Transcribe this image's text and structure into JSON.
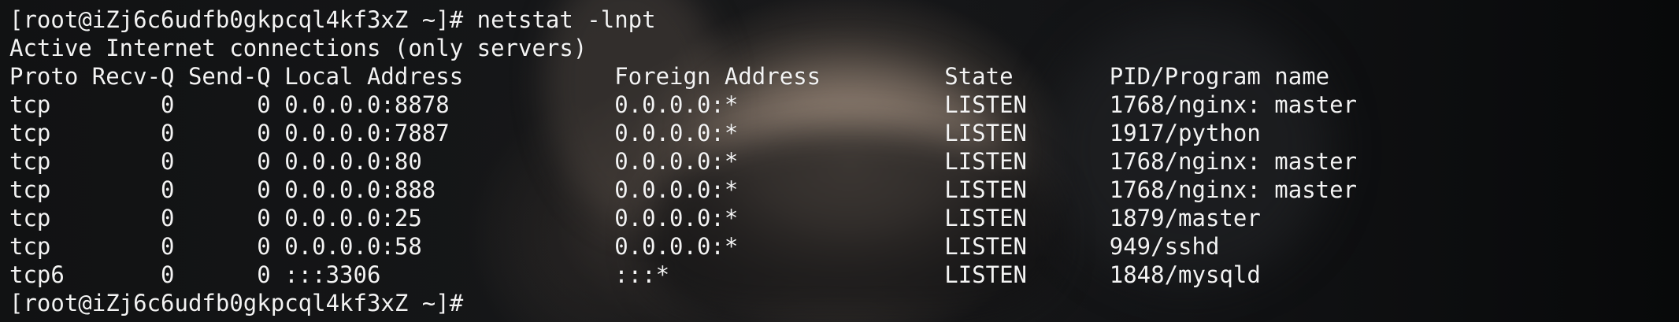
{
  "terminal": {
    "prompt": "[root@iZj6c6udfb0gkpcql4kf3xZ ~]# ",
    "command": "netstat -lnpt",
    "summary": "Active Internet connections (only servers)",
    "header": "Proto Recv-Q Send-Q Local Address           Foreign Address         State       PID/Program name",
    "rows": [
      "tcp        0      0 0.0.0.0:8878            0.0.0.0:*               LISTEN      1768/nginx: master",
      "tcp        0      0 0.0.0.0:7887            0.0.0.0:*               LISTEN      1917/python",
      "tcp        0      0 0.0.0.0:80              0.0.0.0:*               LISTEN      1768/nginx: master",
      "tcp        0      0 0.0.0.0:888             0.0.0.0:*               LISTEN      1768/nginx: master",
      "tcp        0      0 0.0.0.0:25              0.0.0.0:*               LISTEN      1879/master",
      "tcp        0      0 0.0.0.0:58              0.0.0.0:*               LISTEN      949/sshd",
      "tcp6       0      0 :::3306                 :::*                    LISTEN      1848/mysqld"
    ],
    "final_prompt": "[root@iZj6c6udfb0gkpcql4kf3xZ ~]#"
  },
  "colors": {
    "text": "#f3f3f3",
    "background": "#0b0c0d"
  }
}
